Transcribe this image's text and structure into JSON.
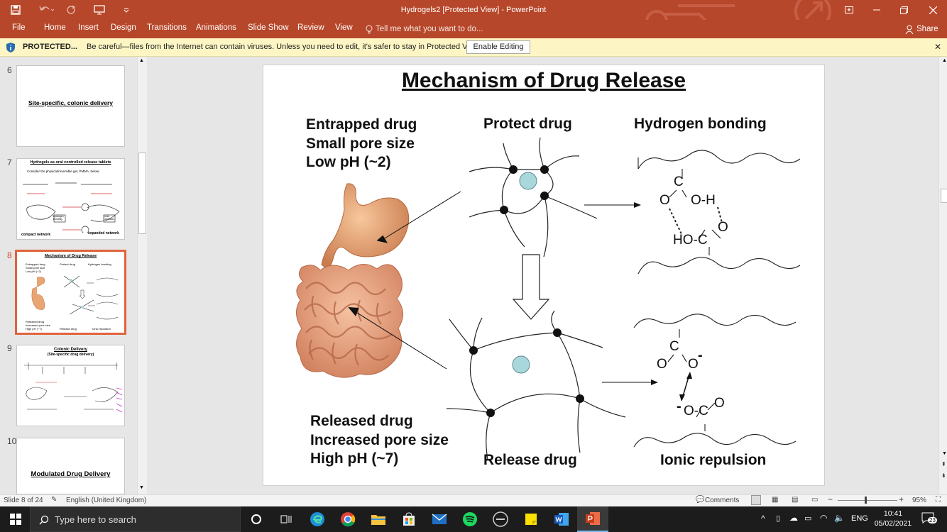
{
  "titlebar": {
    "title": "Hydrogels2 [Protected View] - PowerPoint"
  },
  "ribbon": {
    "tabs": [
      "File",
      "Home",
      "Insert",
      "Design",
      "Transitions",
      "Animations",
      "Slide Show",
      "Review",
      "View"
    ],
    "tell_me": "Tell me what you want to do...",
    "share": "Share"
  },
  "protected": {
    "label": "PROTECTED...",
    "message": "Be careful—files from the Internet can contain viruses. Unless you need to edit, it's safer to stay in Protected View.",
    "button": "Enable Editing"
  },
  "thumbs": {
    "s6": {
      "num": "6",
      "title": "Site-specific, colonic delivery"
    },
    "s7": {
      "num": "7",
      "title": "Hydrogels as oral controlled release tablets",
      "line1": "Consider the physical/reversible gel, PMMA, below:",
      "lbl_compact": "compact network",
      "lbl_expanded": "expanded network",
      "lbl_hbond": "hydrogen bonding",
      "lbl_ionic": "ionic repulsion"
    },
    "s8": {
      "num": "8",
      "title": "Mechanism of Drug Release",
      "entrapped": "Entrapped drug\nSmall pore size\nLow pH (~2)",
      "protect": "Protect drug",
      "hbond": "Hydrogen bonding",
      "released": "Released drug\nIncreased pore size\nHigh pH (~7)",
      "release": "Release drug",
      "ionic": "Ionic repulsion"
    },
    "s9": {
      "num": "9",
      "title": "Colonic Delivery",
      "subtitle": "(Site-specific drug delivery)"
    },
    "s10": {
      "num": "10",
      "title": "Modulated Drug Delivery"
    }
  },
  "slide": {
    "title": "Mechanism of Drug Release",
    "entrapped": "Entrapped drug\nSmall pore size\nLow pH (~2)",
    "protect": "Protect drug",
    "hbond": "Hydrogen bonding",
    "released": "Released drug\nIncreased pore size\nHigh pH (~7)",
    "release": "Release drug",
    "ionic": "Ionic repulsion",
    "chem_c1": "C",
    "chem_o1": "O",
    "chem_oh": "O-H",
    "chem_o2": "O",
    "chem_hoc": "HO-C",
    "chem_c2": "C",
    "chem_o3": "O",
    "chem_o4": "O",
    "chem_minus1": "-",
    "chem_minus2": "-",
    "chem_oc": "O-C",
    "chem_o5": "O"
  },
  "status": {
    "slide": "Slide 8 of 24",
    "lang": "English (United Kingdom)",
    "comments": "Comments",
    "zoom": "95%",
    "zoom_fraction": 0.45
  },
  "taskbar": {
    "search": "Type here to search",
    "lang": "ENG",
    "time": "10:41",
    "date": "05/02/2021",
    "notif": "23"
  },
  "colors": {
    "accent": "#b7472a",
    "drug": "#a9d8dc",
    "selected": "#e0633c"
  }
}
